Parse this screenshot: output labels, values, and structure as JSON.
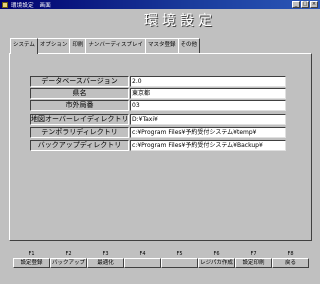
{
  "window": {
    "title": "環境設定　画面"
  },
  "header": {
    "title": "環境設定"
  },
  "tabs": [
    {
      "label": "システム"
    },
    {
      "label": "オプション"
    },
    {
      "label": "印刷"
    },
    {
      "label": "ナンバーディスプレイ"
    },
    {
      "label": "マスタ登録"
    },
    {
      "label": "その他"
    }
  ],
  "active_tab": "システム",
  "fields": [
    {
      "label": "データベースバージョン",
      "value": "2.0"
    },
    {
      "label": "県名",
      "value": "東京都"
    },
    {
      "label": "市外局番",
      "value": "03"
    },
    {
      "label": "地図オーバーレイディレクトリ",
      "value": "D:¥Taxi¥"
    },
    {
      "label": "テンポラリディレクトリ",
      "value": "c:¥Program Files¥予約受付システム¥temp¥"
    },
    {
      "label": "バックアップディレクトリ",
      "value": "c:¥Program Files¥予約受付システム¥Backup¥"
    }
  ],
  "fkeys": [
    {
      "key": "F1",
      "label": "設定登録"
    },
    {
      "key": "F2",
      "label": "バックアップ"
    },
    {
      "key": "F3",
      "label": "最適化"
    },
    {
      "key": "F4",
      "label": ""
    },
    {
      "key": "F5",
      "label": ""
    },
    {
      "key": "F6",
      "label": "レジパカ作成"
    },
    {
      "key": "F7",
      "label": "設定印刷"
    },
    {
      "key": "F8",
      "label": "戻る"
    }
  ]
}
